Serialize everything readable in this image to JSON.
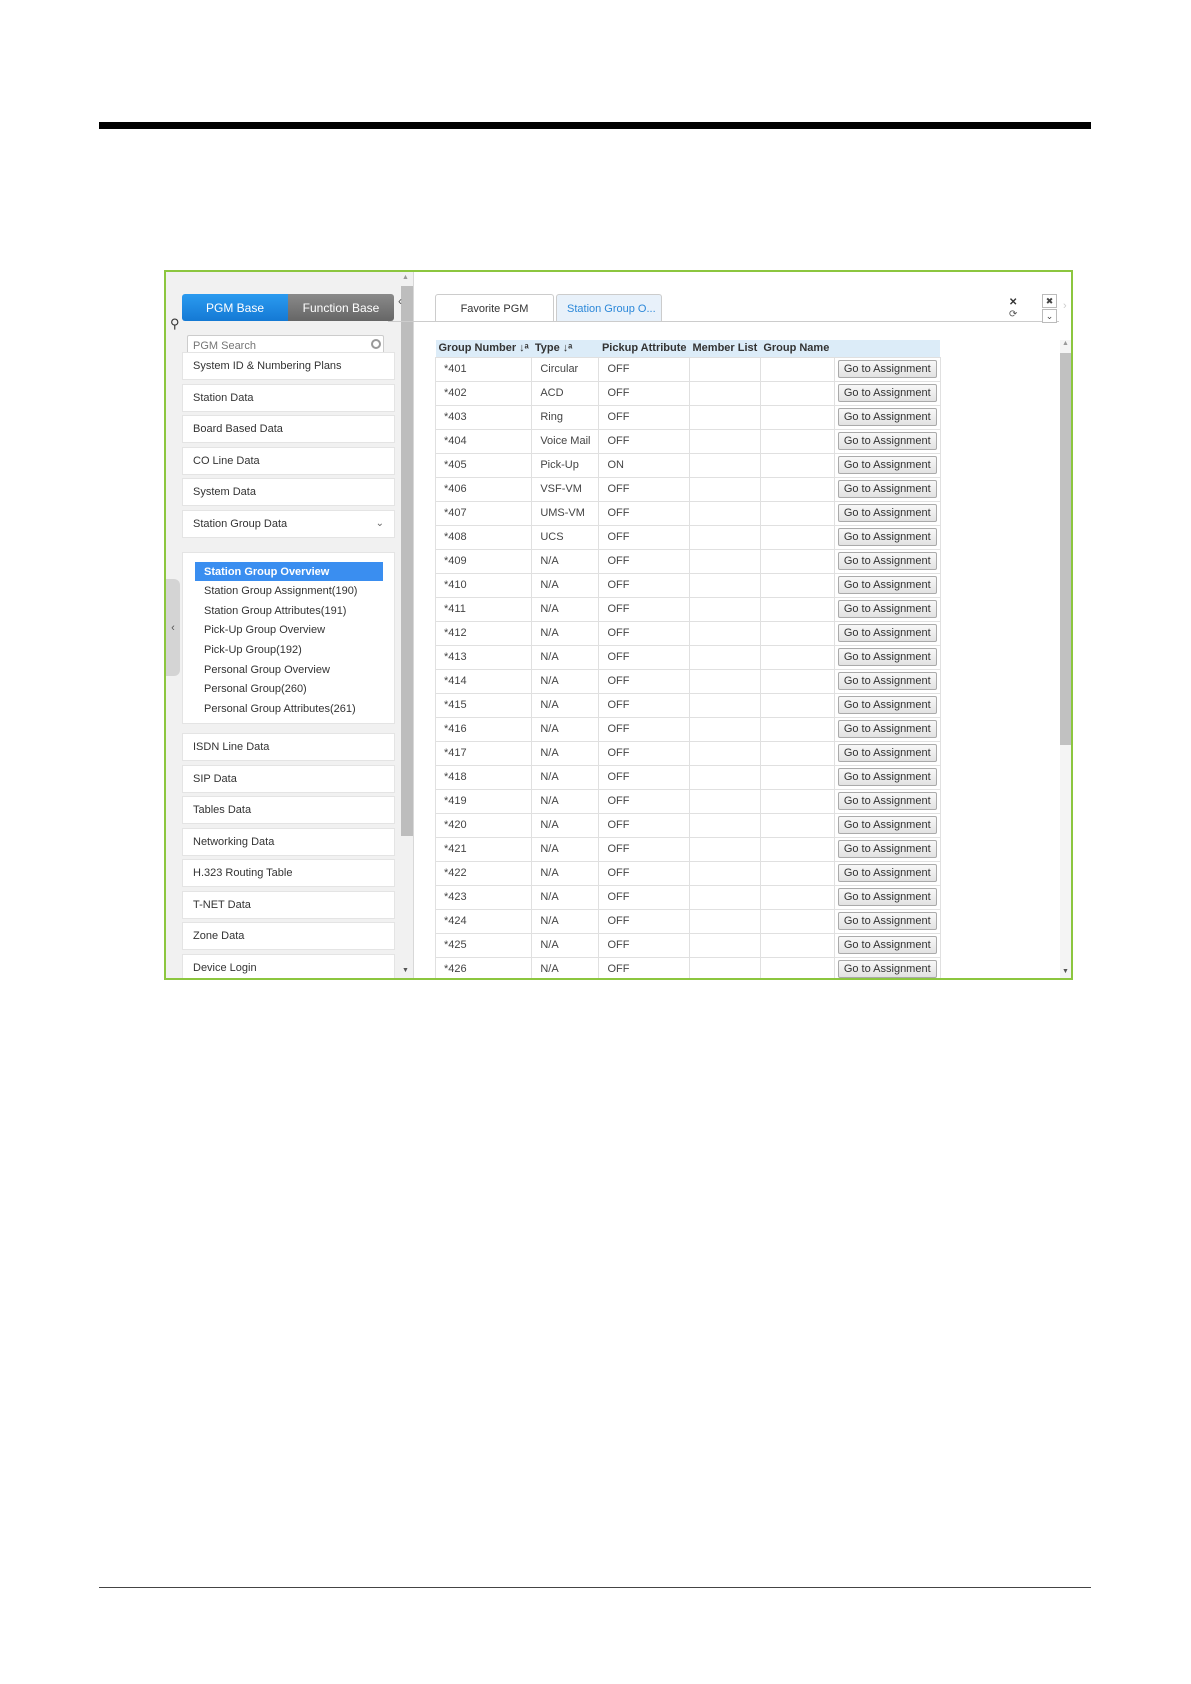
{
  "sidebar": {
    "segments": {
      "pgm_base": "PGM Base",
      "function_base": "Function Base"
    },
    "search": {
      "placeholder": "PGM Search"
    },
    "items_top": [
      "System ID & Numbering Plans",
      "Station Data",
      "Board Based Data",
      "CO Line Data",
      "System Data",
      "Station Group Data"
    ],
    "sub_items": [
      "Station Group Overview",
      "Station Group Assignment(190)",
      "Station Group Attributes(191)",
      "Pick-Up Group Overview",
      "Pick-Up Group(192)",
      "Personal Group Overview",
      "Personal Group(260)",
      "Personal Group Attributes(261)"
    ],
    "active_sub": "Station Group Overview",
    "items_bottom": [
      "ISDN Line Data",
      "SIP Data",
      "Tables Data",
      "Networking Data",
      "H.323 Routing Table",
      "T-NET Data",
      "Zone Data",
      "Device Login"
    ]
  },
  "tabs": [
    {
      "label": "Favorite PGM"
    },
    {
      "label": "Station Group O..."
    }
  ],
  "table": {
    "headers": [
      "Group Number ↓ᵃ",
      "Type ↓ᵃ",
      "Pickup Attribute",
      "Member List",
      "Group Name",
      ""
    ],
    "button_label": "Go to Assignment",
    "rows": [
      [
        "*401",
        "Circular",
        "OFF"
      ],
      [
        "*402",
        "ACD",
        "OFF"
      ],
      [
        "*403",
        "Ring",
        "OFF"
      ],
      [
        "*404",
        "Voice Mail",
        "OFF"
      ],
      [
        "*405",
        "Pick-Up",
        "ON"
      ],
      [
        "*406",
        "VSF-VM",
        "OFF"
      ],
      [
        "*407",
        "UMS-VM",
        "OFF"
      ],
      [
        "*408",
        "UCS",
        "OFF"
      ],
      [
        "*409",
        "N/A",
        "OFF"
      ],
      [
        "*410",
        "N/A",
        "OFF"
      ],
      [
        "*411",
        "N/A",
        "OFF"
      ],
      [
        "*412",
        "N/A",
        "OFF"
      ],
      [
        "*413",
        "N/A",
        "OFF"
      ],
      [
        "*414",
        "N/A",
        "OFF"
      ],
      [
        "*415",
        "N/A",
        "OFF"
      ],
      [
        "*416",
        "N/A",
        "OFF"
      ],
      [
        "*417",
        "N/A",
        "OFF"
      ],
      [
        "*418",
        "N/A",
        "OFF"
      ],
      [
        "*419",
        "N/A",
        "OFF"
      ],
      [
        "*420",
        "N/A",
        "OFF"
      ],
      [
        "*421",
        "N/A",
        "OFF"
      ],
      [
        "*422",
        "N/A",
        "OFF"
      ],
      [
        "*423",
        "N/A",
        "OFF"
      ],
      [
        "*424",
        "N/A",
        "OFF"
      ],
      [
        "*425",
        "N/A",
        "OFF"
      ],
      [
        "*426",
        "N/A",
        "OFF"
      ]
    ]
  },
  "colors": {
    "frame": "#8cc63f",
    "accent": "#3a8ef0",
    "header_bg": "#dcecf8"
  }
}
